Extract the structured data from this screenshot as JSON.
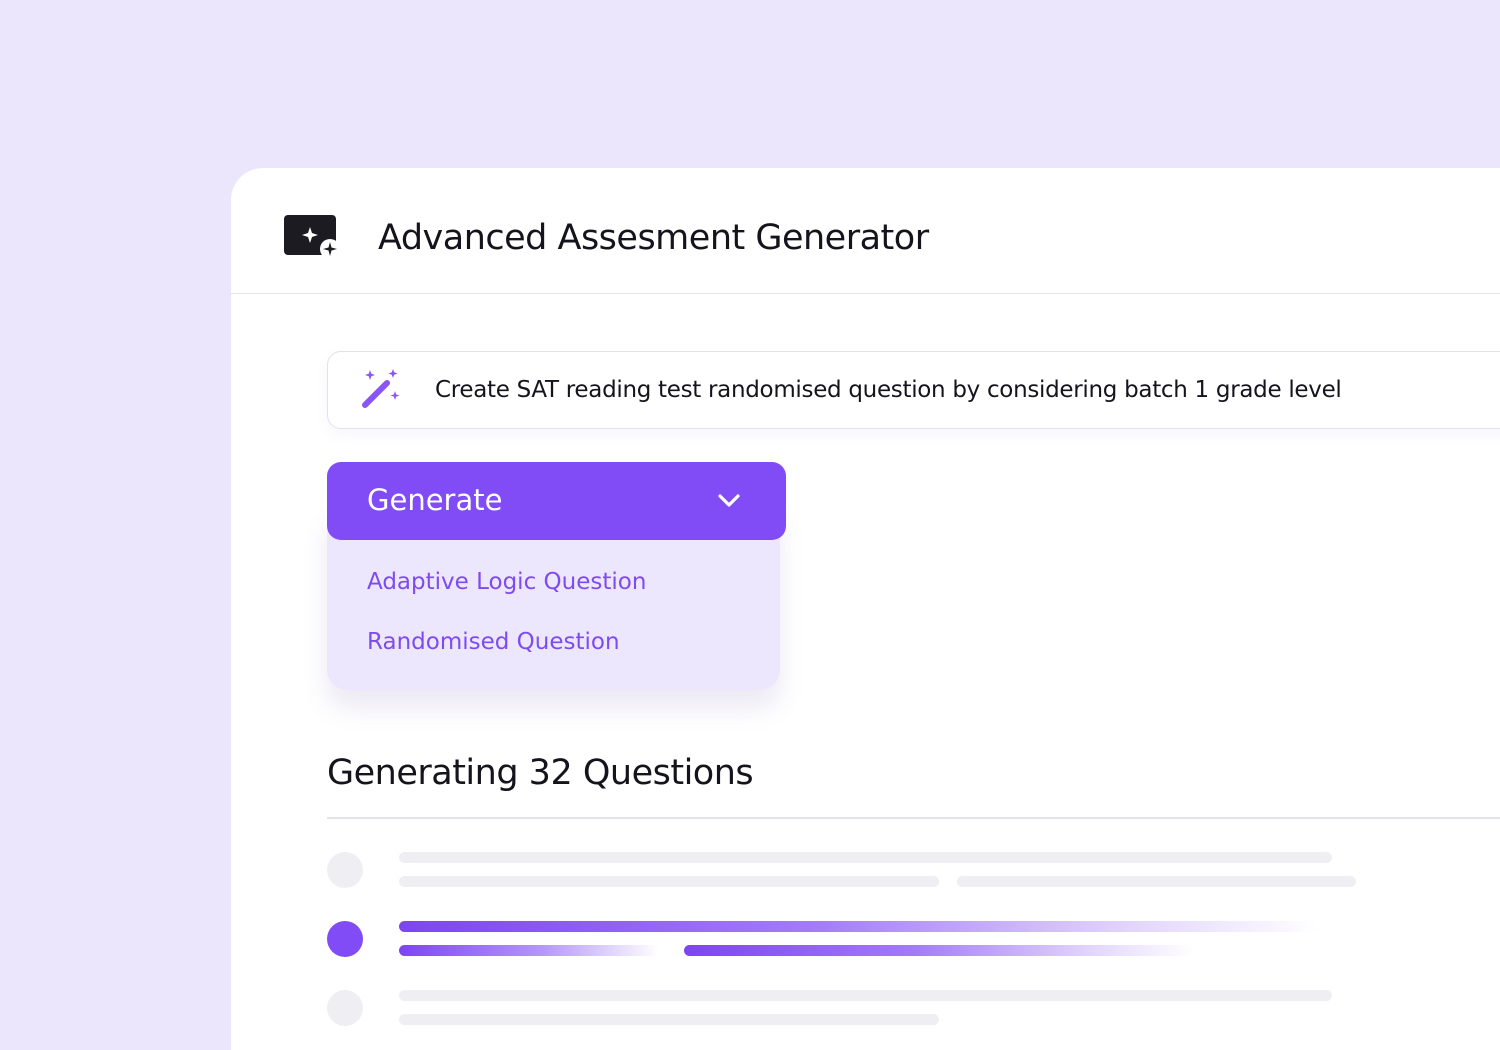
{
  "header": {
    "title": "Advanced Assesment Generator",
    "icon": "ai-generator-icon"
  },
  "prompt": {
    "icon": "magic-wand-icon",
    "text": "Create SAT reading test randomised question by considering batch 1 grade level"
  },
  "generate_button": {
    "label": "Generate",
    "icon": "chevron-down-icon"
  },
  "dropdown": {
    "items": [
      {
        "label": "Adaptive Logic Question"
      },
      {
        "label": "Randomised Question"
      }
    ]
  },
  "results": {
    "title": "Generating 32 Questions",
    "rows": [
      {
        "state": "pending"
      },
      {
        "state": "generating"
      },
      {
        "state": "pending"
      }
    ]
  },
  "colors": {
    "background": "#ECE6FD",
    "accent": "#814CF5",
    "menu_background": "#EDE7FD",
    "menu_text": "#7E4BF0",
    "placeholder": "#EFEEF2",
    "text": "#15131C"
  }
}
